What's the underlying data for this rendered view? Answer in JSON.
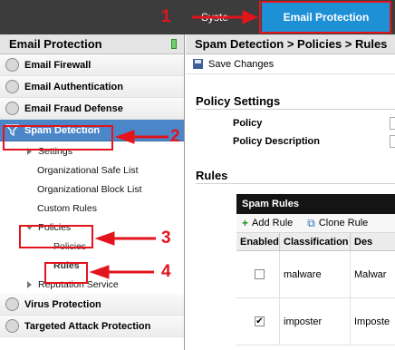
{
  "topbar": {
    "system_label": "Syste",
    "email_protection_label": "Email Protection"
  },
  "sidebar": {
    "title": "Email Protection",
    "sections": [
      {
        "label": "Email Firewall"
      },
      {
        "label": "Email Authentication"
      },
      {
        "label": "Email Fraud Defense"
      },
      {
        "label": "Spam Detection"
      }
    ],
    "sub_items": {
      "settings": "Settings",
      "safe_list": "Organizational Safe List",
      "block_list": "Organizational Block List",
      "custom_rules": "Custom Rules",
      "policies": "Policies",
      "policies_child": "Policies",
      "rules": "Rules",
      "reputation_service": "Reputation Service"
    },
    "bottom_sections": [
      {
        "label": "Virus Protection"
      },
      {
        "label": "Targeted Attack Protection"
      }
    ]
  },
  "main": {
    "breadcrumb": "Spam Detection > Policies > Rules",
    "save_label": "Save Changes",
    "policy_settings_heading": "Policy Settings",
    "policy_label": "Policy",
    "policy_description_label": "Policy Description",
    "rules_heading": "Rules",
    "table": {
      "title": "Spam Rules",
      "add_rule": "Add Rule",
      "clone_rule": "Clone Rule",
      "columns": [
        "Enabled",
        "Classification",
        "Des"
      ],
      "rows": [
        {
          "enabled": false,
          "classification": "malware",
          "description": "Malwar"
        },
        {
          "enabled": true,
          "classification": "imposter",
          "description": "Imposte"
        }
      ]
    }
  },
  "annotations": [
    "1",
    "2",
    "3",
    "4"
  ],
  "colors": {
    "accent": "#1e90d6",
    "active": "#4a86c8",
    "annotation": "#e3141c"
  }
}
